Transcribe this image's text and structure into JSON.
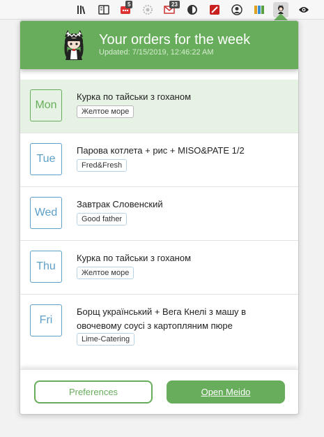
{
  "toolbar": {
    "icons": [
      {
        "name": "library-icon"
      },
      {
        "name": "reader-view-icon"
      },
      {
        "name": "extension-red-icon",
        "badge": "5"
      },
      {
        "name": "settings-cog-icon"
      },
      {
        "name": "mail-icon",
        "badge": "23"
      },
      {
        "name": "privacy-icon"
      },
      {
        "name": "pen-extension-icon"
      },
      {
        "name": "account-icon"
      },
      {
        "name": "colorful-extension-icon"
      },
      {
        "name": "meido-icon"
      },
      {
        "name": "eye-icon"
      }
    ]
  },
  "header": {
    "title": "Your orders for the week",
    "updated": "Updated: 7/15/2019, 12:46:22 AM"
  },
  "orders": [
    {
      "day": "Mon",
      "dish": "Курка по тайськи з гоханом",
      "vendor": "Желтое море",
      "active": true
    },
    {
      "day": "Tue",
      "dish": "Парова котлета + рис + MISO&PATE 1/2",
      "vendor": "Fred&Fresh"
    },
    {
      "day": "Wed",
      "dish": "Завтрак Словенский",
      "vendor": "Good father"
    },
    {
      "day": "Thu",
      "dish": "Курка по тайськи з гоханом",
      "vendor": "Желтое море"
    },
    {
      "day": "Fri",
      "dish": "Борщ український + Вега Кнелі з машу в овочевому соусі з картопляним пюре",
      "vendor": "Lime-Catering"
    }
  ],
  "footer": {
    "preferences": "Preferences",
    "open": "Open Meido"
  },
  "colors": {
    "accent": "#67ad5b",
    "day_border": "#5ea0c8",
    "active_row": "#e6f2e3"
  }
}
